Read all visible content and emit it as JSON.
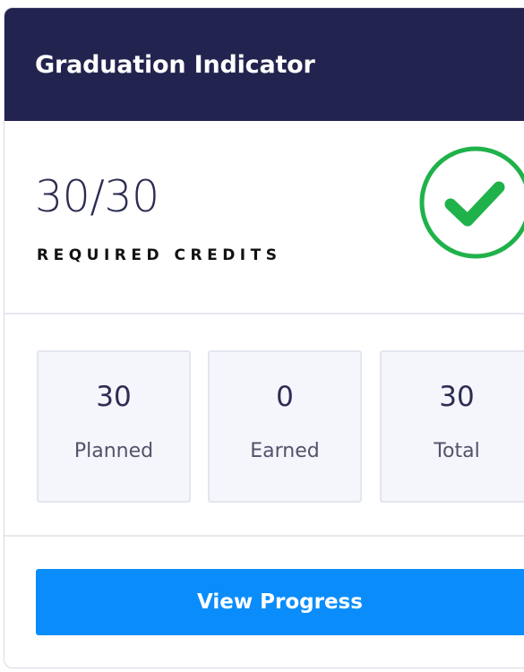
{
  "card": {
    "title": "Graduation Indicator"
  },
  "credits": {
    "value": "30/30",
    "label": "REQUIRED CREDITS",
    "status_icon": "check-circle-icon",
    "status_color": "#1fb24a"
  },
  "stats": [
    {
      "value": "30",
      "label": "Planned"
    },
    {
      "value": "0",
      "label": "Earned"
    },
    {
      "value": "30",
      "label": "Total"
    }
  ],
  "actions": {
    "view_progress_label": "View Progress",
    "button_color": "#0a8dfb"
  },
  "colors": {
    "header_bg": "#22244f",
    "text_primary": "#2c2d52"
  }
}
